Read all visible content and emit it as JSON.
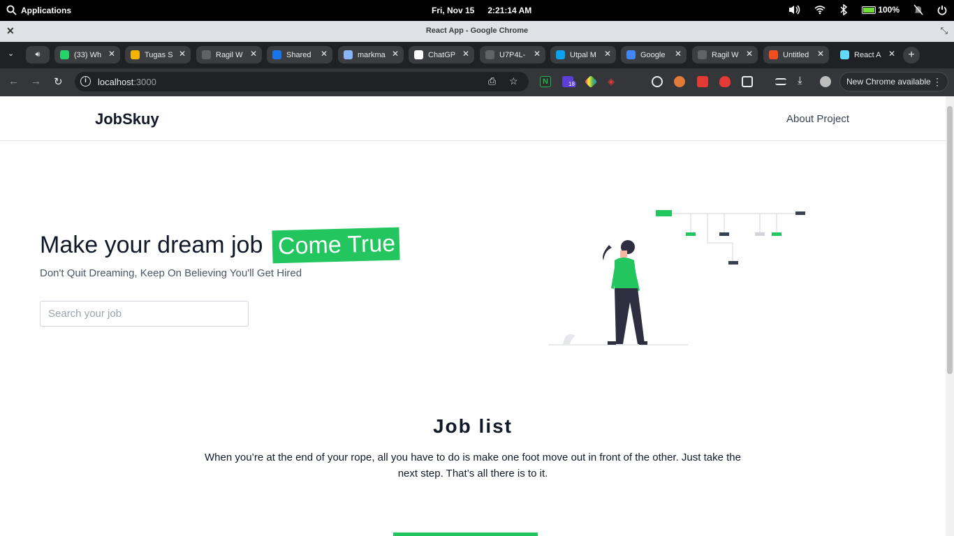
{
  "os": {
    "apps_label": "Applications",
    "date": "Fri, Nov 15",
    "time": "2:21:14 AM",
    "battery": "100%"
  },
  "window": {
    "title": "React App - Google Chrome"
  },
  "tabs": [
    {
      "label": "(33) Wh",
      "color": "#25d366",
      "badge": "33"
    },
    {
      "label": "Tugas S",
      "color": "#f4b400"
    },
    {
      "label": "Ragil W",
      "color": "#5f6368"
    },
    {
      "label": "Shared",
      "color": "#1a73e8"
    },
    {
      "label": "markma",
      "color": "#8ab4f8"
    },
    {
      "label": "ChatGP",
      "color": "#ffffff"
    },
    {
      "label": "U7P4L-",
      "color": "#5f6368"
    },
    {
      "label": "Utpal M",
      "color": "#0aa2f2"
    },
    {
      "label": "Google",
      "color": "#4285f4"
    },
    {
      "label": "Ragil W",
      "color": "#5f6368"
    },
    {
      "label": "Untitled",
      "color": "#f24e1e"
    },
    {
      "label": "React A",
      "color": "#61dafb",
      "active": true
    }
  ],
  "toolbar": {
    "url_host": "localhost",
    "url_port": ":3000",
    "update_label": "New Chrome available",
    "ext_badge": "18"
  },
  "site": {
    "logo": "JobSkuy",
    "nav_link": "About Project",
    "hero_title_plain": "Make your dream job",
    "hero_title_highlight": "Come True",
    "hero_subtitle": "Don't Quit Dreaming, Keep On Believing You'll Get Hired",
    "search_placeholder": "Search your job",
    "joblist_title": "Job list",
    "joblist_desc": "When you’re at the end of your rope, all you have to do is make one foot move out in front of the other. Just take the next step. That’s all there is to it."
  },
  "colors": {
    "accent": "#22c55e",
    "dark": "#111827"
  }
}
